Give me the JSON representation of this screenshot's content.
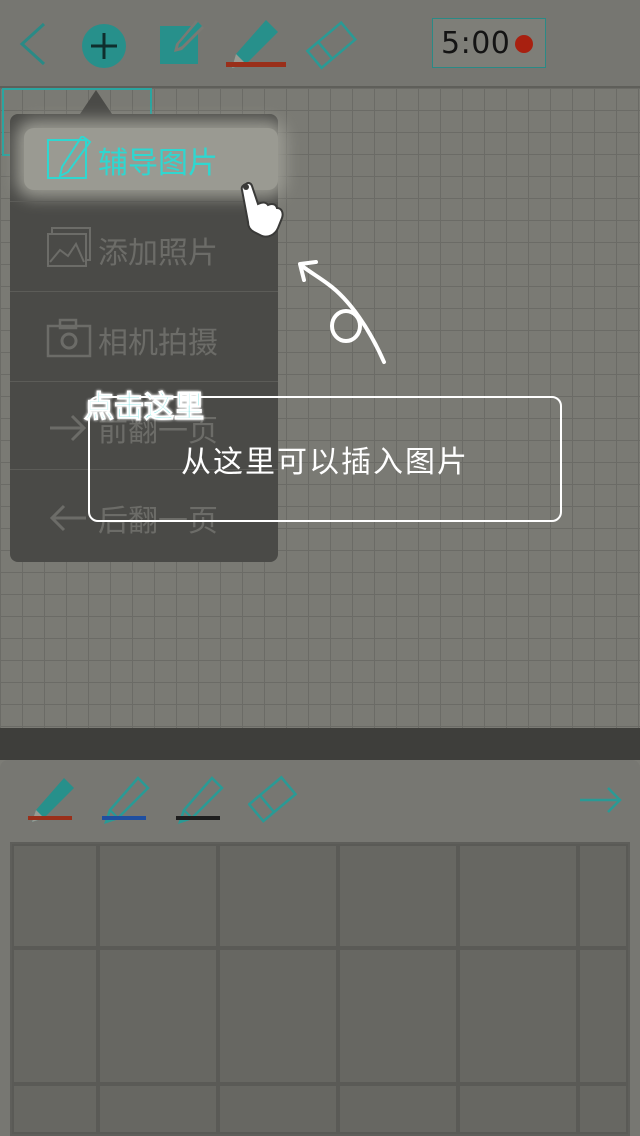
{
  "toolbar": {
    "back_icon": "chevron-left-icon",
    "add_icon": "plus-circle-icon",
    "edit_icon": "edit-square-icon",
    "pen_icon": "pen-icon",
    "eraser_icon": "eraser-icon",
    "timer": "5:00",
    "accent_color": "#2a9a95",
    "pen_color": "#9a2f1a"
  },
  "menu": {
    "items": [
      {
        "label": "辅导图片",
        "icon": "pencil-frame-icon",
        "active": true
      },
      {
        "label": "添加照片",
        "icon": "photo-gallery-icon"
      },
      {
        "label": "相机拍摄",
        "icon": "camera-icon"
      },
      {
        "label": "前翻一页",
        "icon": "arrow-right-icon"
      },
      {
        "label": "后翻一页",
        "icon": "arrow-left-icon"
      }
    ]
  },
  "tutorial": {
    "tag": "点击这里",
    "text": "从这里可以插入图片"
  },
  "palette": {
    "pens": [
      {
        "icon": "pen-icon",
        "color": "#9a2f1a"
      },
      {
        "icon": "pen-icon",
        "color": "#1f4fa0"
      },
      {
        "icon": "pen-icon",
        "color": "#1e1e1e"
      }
    ],
    "eraser_icon": "eraser-icon",
    "next_icon": "arrow-right-icon"
  }
}
